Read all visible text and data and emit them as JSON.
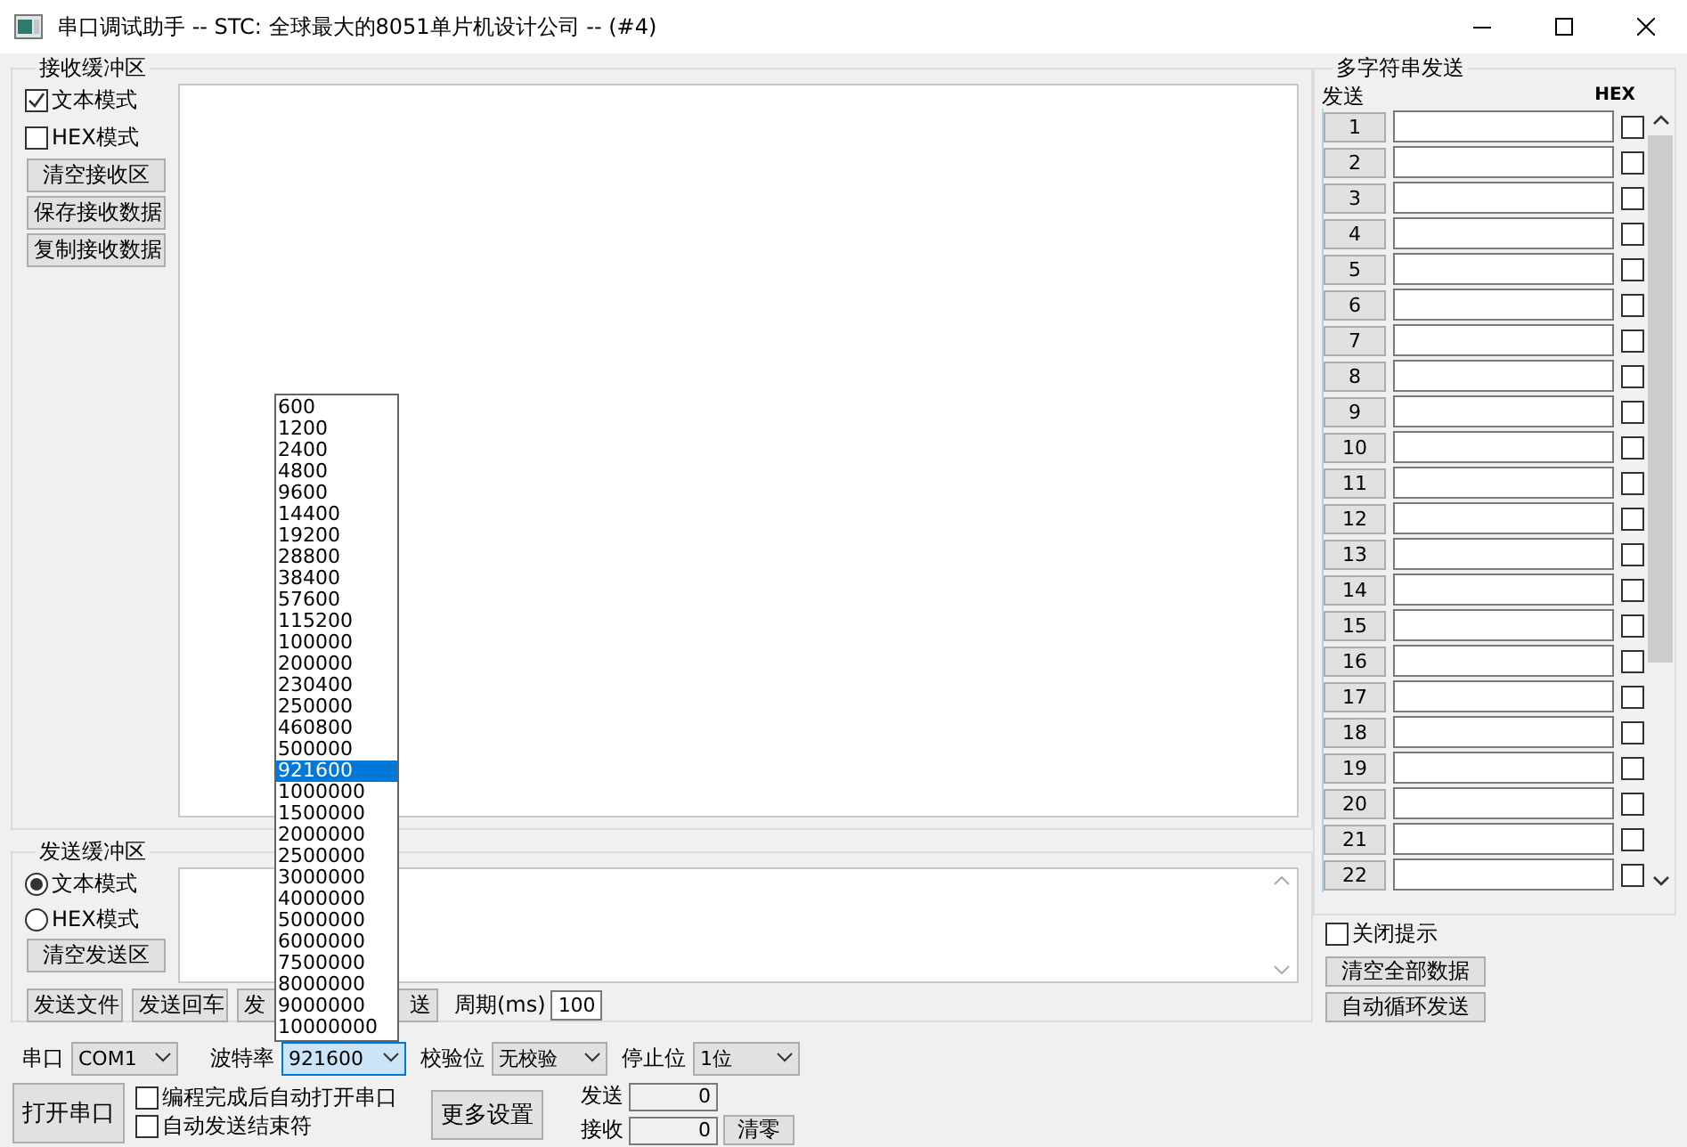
{
  "window": {
    "title": "串口调试助手 -- STC: 全球最大的8051单片机设计公司 -- (#4)"
  },
  "receive": {
    "title": "接收缓冲区",
    "modes": [
      {
        "label": "文本模式",
        "checked": true
      },
      {
        "label": "HEX模式",
        "checked": false
      }
    ],
    "buttons": [
      "清空接收区",
      "保存接收数据",
      "复制接收数据"
    ]
  },
  "send": {
    "title": "发送缓冲区",
    "modes": [
      {
        "label": "文本模式",
        "selected": true
      },
      {
        "label": "HEX模式",
        "selected": false
      }
    ],
    "clear_button": "清空发送区",
    "buttons": [
      "发送文件",
      "发送回车",
      "发",
      "送"
    ],
    "period_label": "周期(ms)",
    "period_value": "100"
  },
  "serial": {
    "port_label": "串口",
    "port": "COM1",
    "baud_label": "波特率",
    "baud": "921600",
    "parity_label": "校验位",
    "parity": "无校验",
    "stop_label": "停止位",
    "stop": "1位",
    "open_button": "打开串口",
    "options": [
      {
        "label": "编程完成后自动打开串口",
        "checked": false
      },
      {
        "label": "自动发送结束符",
        "checked": false
      }
    ],
    "more_button": "更多设置",
    "sent_label": "发送",
    "sent": "0",
    "received_label": "接收",
    "received": "0",
    "reset_button": "清零"
  },
  "baud_list": {
    "items": [
      {
        "label": "600",
        "selected": false
      },
      {
        "label": "1200",
        "selected": false
      },
      {
        "label": "2400",
        "selected": false
      },
      {
        "label": "4800",
        "selected": false
      },
      {
        "label": "9600",
        "selected": false
      },
      {
        "label": "14400",
        "selected": false
      },
      {
        "label": "19200",
        "selected": false
      },
      {
        "label": "28800",
        "selected": false
      },
      {
        "label": "38400",
        "selected": false
      },
      {
        "label": "57600",
        "selected": false
      },
      {
        "label": "115200",
        "selected": false
      },
      {
        "label": "100000",
        "selected": false
      },
      {
        "label": "200000",
        "selected": false
      },
      {
        "label": "230400",
        "selected": false
      },
      {
        "label": "250000",
        "selected": false
      },
      {
        "label": "460800",
        "selected": false
      },
      {
        "label": "500000",
        "selected": false
      },
      {
        "label": "921600",
        "selected": true
      },
      {
        "label": "1000000",
        "selected": false
      },
      {
        "label": "1500000",
        "selected": false
      },
      {
        "label": "2000000",
        "selected": false
      },
      {
        "label": "2500000",
        "selected": false
      },
      {
        "label": "3000000",
        "selected": false
      },
      {
        "label": "4000000",
        "selected": false
      },
      {
        "label": "5000000",
        "selected": false
      },
      {
        "label": "6000000",
        "selected": false
      },
      {
        "label": "7500000",
        "selected": false
      },
      {
        "label": "8000000",
        "selected": false
      },
      {
        "label": "9000000",
        "selected": false
      },
      {
        "label": "10000000",
        "selected": false
      }
    ]
  },
  "multi": {
    "title": "多字符串发送",
    "send_header": "发送",
    "hex_header": "HEX",
    "rows": [
      {
        "label": "1",
        "hex": false
      },
      {
        "label": "2",
        "hex": false
      },
      {
        "label": "3",
        "hex": false
      },
      {
        "label": "4",
        "hex": false
      },
      {
        "label": "5",
        "hex": false
      },
      {
        "label": "6",
        "hex": false
      },
      {
        "label": "7",
        "hex": false
      },
      {
        "label": "8",
        "hex": false
      },
      {
        "label": "9",
        "hex": false
      },
      {
        "label": "10",
        "hex": false
      },
      {
        "label": "11",
        "hex": false
      },
      {
        "label": "12",
        "hex": false
      },
      {
        "label": "13",
        "hex": false
      },
      {
        "label": "14",
        "hex": false
      },
      {
        "label": "15",
        "hex": false
      },
      {
        "label": "16",
        "hex": false
      },
      {
        "label": "17",
        "hex": false
      },
      {
        "label": "18",
        "hex": false
      },
      {
        "label": "19",
        "hex": false
      },
      {
        "label": "20",
        "hex": false
      },
      {
        "label": "21",
        "hex": false
      },
      {
        "label": "22",
        "hex": false
      }
    ],
    "close_tips": {
      "label": "关闭提示",
      "checked": false
    },
    "buttons": [
      "清空全部数据",
      "自动循环发送"
    ]
  }
}
